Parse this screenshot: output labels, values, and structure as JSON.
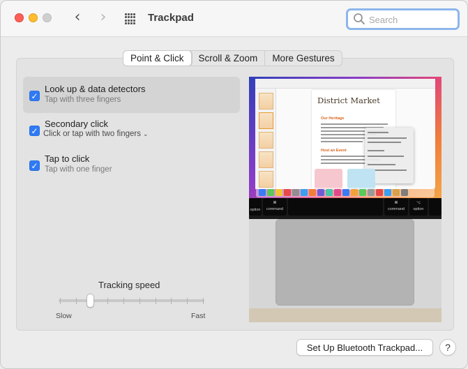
{
  "window": {
    "title": "Trackpad"
  },
  "search": {
    "placeholder": "Search"
  },
  "tabs": [
    {
      "label": "Point & Click",
      "active": true
    },
    {
      "label": "Scroll & Zoom",
      "active": false
    },
    {
      "label": "More Gestures",
      "active": false
    }
  ],
  "options": [
    {
      "title": "Look up & data detectors",
      "subtitle": "Tap with three fingers",
      "checked": true,
      "selected": true
    },
    {
      "title": "Secondary click",
      "subtitle": "Click or tap with two fingers",
      "checked": true,
      "selected": false,
      "has_dropdown": true
    },
    {
      "title": "Tap to click",
      "subtitle": "Tap with one finger",
      "checked": true,
      "selected": false
    }
  ],
  "tracking": {
    "label": "Tracking speed",
    "min_label": "Slow",
    "max_label": "Fast",
    "value_fraction": 0.21,
    "ticks": 10
  },
  "preview": {
    "doc_title": "District Market",
    "doc_heading_1": "Our Heritage",
    "doc_heading_2": "Host an Event",
    "key_left_symbol": "⌘",
    "key_left_label": "command",
    "key_left2_label": "option",
    "key_right_symbol": "⌘",
    "key_right_label": "command",
    "key_right2_symbol": "⌥",
    "key_right2_label": "option"
  },
  "footer": {
    "bluetooth_button": "Set Up Bluetooth Trackpad...",
    "help_button": "?"
  },
  "colors": {
    "accent": "#2f7bf5",
    "close": "#fe5f57",
    "minimize": "#febc2e"
  },
  "icons": {
    "back": "chevron-left-icon",
    "forward": "chevron-right-icon",
    "grid": "grid-icon",
    "search": "search-icon"
  }
}
